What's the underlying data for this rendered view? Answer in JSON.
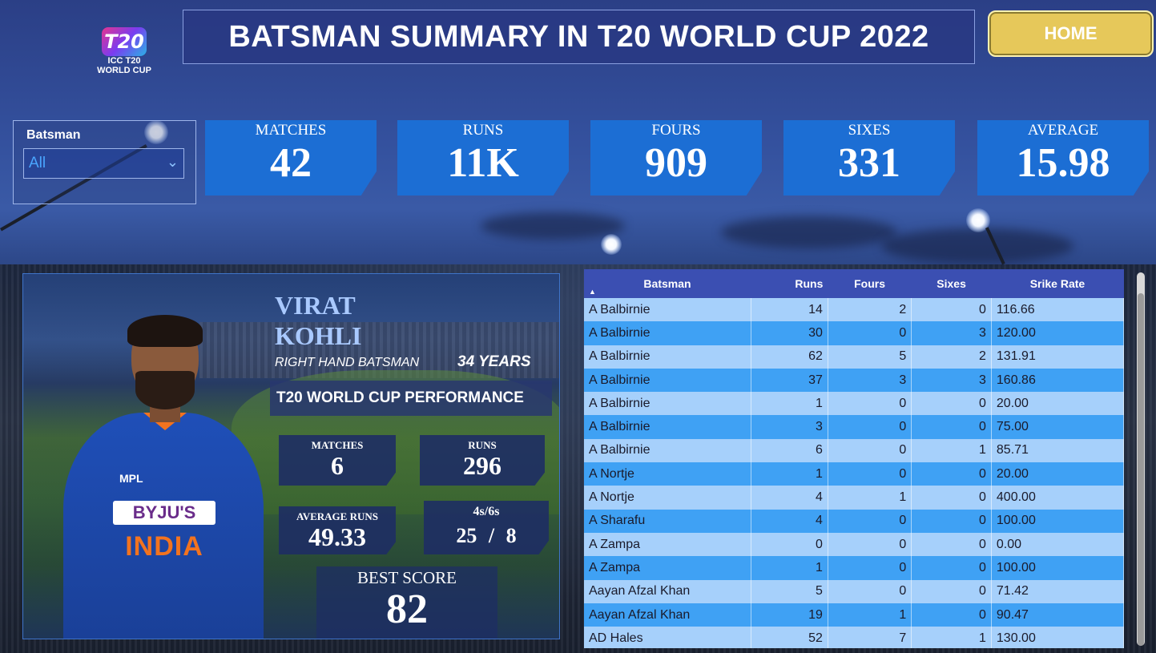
{
  "header": {
    "title": "BATSMAN SUMMARY IN T20 WORLD CUP 2022",
    "home_label": "HOME"
  },
  "logo": {
    "mark": "T20",
    "line1": "ICC T20",
    "line2": "WORLD CUP"
  },
  "slicer": {
    "label": "Batsman",
    "value": "All"
  },
  "kpis": [
    {
      "label": "MATCHES",
      "value": "42"
    },
    {
      "label": "RUNS",
      "value": "11K"
    },
    {
      "label": "FOURS",
      "value": "909"
    },
    {
      "label": "SIXES",
      "value": "331"
    },
    {
      "label": "AVERAGE",
      "value": "15.98"
    }
  ],
  "player": {
    "first_name": "VIRAT",
    "last_name": "KOHLI",
    "role": "RIGHT HAND BATSMAN",
    "age": "34 YEARS",
    "performance_heading": "T20 WORLD CUP PERFORMANCE",
    "jersey_sponsor": "BYJU'S",
    "jersey_country": "INDIA",
    "jersey_brand": "MPL",
    "stats": {
      "matches_label": "MATCHES",
      "matches": "6",
      "runs_label": "RUNS",
      "runs": "296",
      "avg_label": "AVERAGE RUNS",
      "avg": "49.33",
      "boundaries_label": "4s/6s",
      "fours": "25",
      "sep": "/",
      "sixes": "8",
      "best_label": "BEST SCORE",
      "best": "82"
    }
  },
  "table": {
    "columns": [
      "Batsman",
      "Runs",
      "Fours",
      "Sixes",
      "Srike Rate"
    ],
    "rows": [
      [
        "A Balbirnie",
        "14",
        "2",
        "0",
        "116.66"
      ],
      [
        "A Balbirnie",
        "30",
        "0",
        "3",
        "120.00"
      ],
      [
        "A Balbirnie",
        "62",
        "5",
        "2",
        "131.91"
      ],
      [
        "A Balbirnie",
        "37",
        "3",
        "3",
        "160.86"
      ],
      [
        "A Balbirnie",
        "1",
        "0",
        "0",
        "20.00"
      ],
      [
        "A Balbirnie",
        "3",
        "0",
        "0",
        "75.00"
      ],
      [
        "A Balbirnie",
        "6",
        "0",
        "1",
        "85.71"
      ],
      [
        "A Nortje",
        "1",
        "0",
        "0",
        "20.00"
      ],
      [
        "A Nortje",
        "4",
        "1",
        "0",
        "400.00"
      ],
      [
        "A Sharafu",
        "4",
        "0",
        "0",
        "100.00"
      ],
      [
        "A Zampa",
        "0",
        "0",
        "0",
        "0.00"
      ],
      [
        "A Zampa",
        "1",
        "0",
        "0",
        "100.00"
      ],
      [
        "Aayan Afzal Khan",
        "5",
        "0",
        "0",
        "71.42"
      ],
      [
        "Aayan Afzal Khan",
        "19",
        "1",
        "0",
        "90.47"
      ],
      [
        "AD Hales",
        "52",
        "7",
        "1",
        "130.00"
      ]
    ]
  }
}
